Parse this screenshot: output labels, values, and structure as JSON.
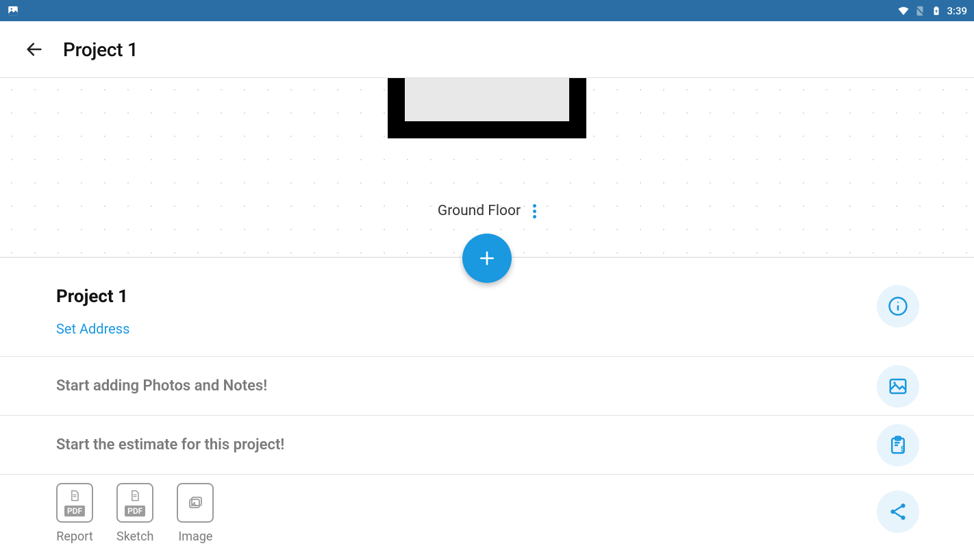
{
  "status_bar": {
    "time": "3:39"
  },
  "app_bar": {
    "title": "Project 1"
  },
  "canvas": {
    "floor_label": "Ground Floor"
  },
  "project_info": {
    "name": "Project 1",
    "set_address_label": "Set Address"
  },
  "rows": {
    "photos_notes_prompt": "Start adding Photos and Notes!",
    "estimate_prompt": "Start the estimate for this project!"
  },
  "exports": {
    "report_label": "Report",
    "sketch_label": "Sketch",
    "image_label": "Image",
    "pdf_badge": "PDF"
  }
}
